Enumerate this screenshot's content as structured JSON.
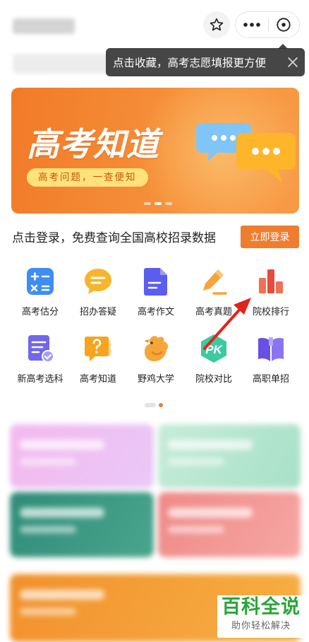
{
  "colors": {
    "accent": "#ee7d2f",
    "banner": "#f4893a",
    "annotation": "#e2231a",
    "watermark": "#2aa53a"
  },
  "header": {
    "star_icon": "star-outline-icon",
    "more_icon": "more-dots-icon",
    "close_icon": "circle-close-icon"
  },
  "tip": {
    "text": "点击收藏，高考志愿填报更方便",
    "close_icon": "x-icon"
  },
  "banner": {
    "title": "高考知道",
    "subtitle": "高考问题，一查便知",
    "slide_count": 3,
    "active_slide": 2
  },
  "login": {
    "prompt": "点击登录，免费查询全国高校招录数据",
    "button": "立即登录"
  },
  "grid": [
    {
      "label": "高考估分",
      "icon": "calculator-icon"
    },
    {
      "label": "招办答疑",
      "icon": "chat-bubble-icon"
    },
    {
      "label": "高考作文",
      "icon": "document-icon"
    },
    {
      "label": "高考真题",
      "icon": "pencil-icon"
    },
    {
      "label": "院校排行",
      "icon": "bar-chart-icon"
    },
    {
      "label": "新高考选科",
      "icon": "checklist-icon"
    },
    {
      "label": "高考知道",
      "icon": "question-bubble-icon"
    },
    {
      "label": "野鸡大学",
      "icon": "chicken-icon"
    },
    {
      "label": "院校对比",
      "icon": "pk-icon"
    },
    {
      "label": "高职单招",
      "icon": "book-icon"
    }
  ],
  "pagination": {
    "pages": 2,
    "active": 2
  },
  "watermark": {
    "main": "百科全说",
    "sub": "助你轻松解决"
  }
}
